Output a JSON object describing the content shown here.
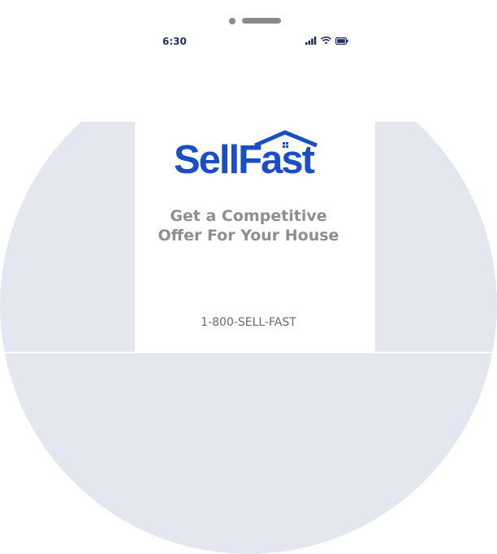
{
  "status_bar": {
    "time": "6:30",
    "icons": [
      "signal-icon",
      "wifi-icon",
      "battery-icon"
    ]
  },
  "brand": {
    "name_part1": "Sell",
    "name_part2": "Fast",
    "color": "#1a4fc4"
  },
  "tagline": {
    "line1": "Get a Competitive",
    "line2": "Offer For Your House"
  },
  "contact": {
    "phone": "1-800-SELL-FAST"
  },
  "colors": {
    "background_circle": "#e4e7ef",
    "tagline_text": "#8f8f8f",
    "status_text": "#1f2f5a"
  }
}
